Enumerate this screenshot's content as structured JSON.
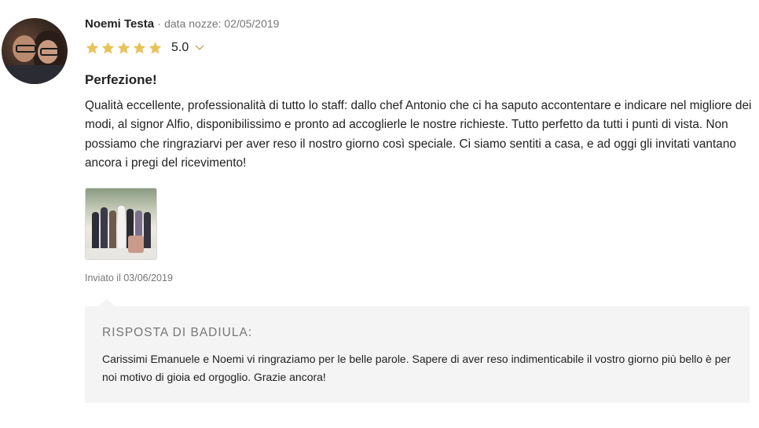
{
  "review": {
    "author": "Noemi Testa",
    "separator": "·",
    "date_label": "data nozze: 02/05/2019",
    "rating": {
      "stars": 5,
      "max_stars": 5,
      "score_text": "5.0",
      "star_color": "#e8c25a"
    },
    "title": "Perfezione!",
    "body": "Qualità eccellente, professionalità di tutto lo staff: dallo chef Antonio che ci ha saputo accontentare e indicare nel migliore dei modi, al signor Alfio, disponibilissimo e pronto ad accoglierle le nostre richieste. Tutto perfetto da tutti i punti di vista. Non possiamo che ringraziarvi per aver reso il nostro giorno così speciale. Ci siamo sentiti a casa, e ad oggi gli invitati vantano ancora i pregi del ricevimento!",
    "sent_label": "Inviato il 03/06/2019",
    "photos": [
      "photo-thumbnail"
    ]
  },
  "reply": {
    "title": "RISPOSTA DI BADIULA:",
    "body": "Carissimi Emanuele e Noemi vi ringraziamo per le belle parole. Sapere di aver reso indimenticabile il vostro giorno più bello è per noi motivo di gioia ed orgoglio. Grazie ancora!"
  },
  "colors": {
    "muted_text": "#767676",
    "reply_background": "#f4f4f4",
    "star": "#e8c25a"
  }
}
